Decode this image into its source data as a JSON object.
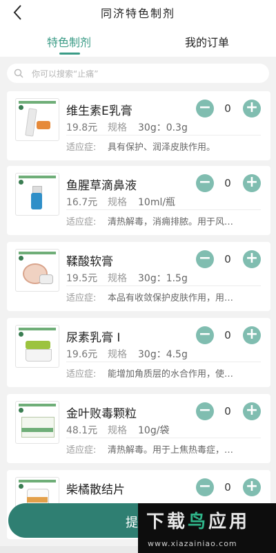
{
  "header": {
    "title": "同济特色制剂"
  },
  "tabs": [
    {
      "label": "特色制剂",
      "active": true
    },
    {
      "label": "我的订单",
      "active": false
    }
  ],
  "search": {
    "placeholder": "你可以搜索“止痛”"
  },
  "labels": {
    "spec": "规格",
    "indication": "适应症:"
  },
  "products": [
    {
      "name": "维生素E乳膏",
      "price": "19.8元",
      "spec": "30g：0.3g",
      "indication": "具有保护、润泽皮肤作用。",
      "qty": "0"
    },
    {
      "name": "鱼腥草滴鼻液",
      "price": "16.7元",
      "spec": "10ml/瓶",
      "indication": "清热解毒，消痈排脓。用于风…",
      "qty": "0"
    },
    {
      "name": "鞣酸软膏",
      "price": "19.5元",
      "spec": "30g：1.5g",
      "indication": "本品有收敛保护皮肤作用，用…",
      "qty": "0"
    },
    {
      "name": "尿素乳膏 I",
      "price": "19.6元",
      "spec": "30g：4.5g",
      "indication": "能增加角质层的水合作用，使…",
      "qty": "0"
    },
    {
      "name": "金叶败毒颗粒",
      "price": "48.1元",
      "spec": "10g/袋",
      "indication": "清热解毒。用于上焦热毒症，…",
      "qty": "0"
    },
    {
      "name": "柴橘散结片",
      "price": "",
      "spec": "",
      "indication": "",
      "qty": "0"
    }
  ],
  "submit": {
    "label": "提"
  },
  "watermark": {
    "main_prefix": "下载",
    "main_accent": "鸟",
    "main_suffix": "应用",
    "url": "www.xiazainiao.com"
  },
  "colors": {
    "accent": "#3a9b86",
    "stepper": "#80bdb0",
    "submit": "#2f7f72"
  },
  "icons": {
    "back": "back-arrow-icon",
    "search": "search-icon",
    "minus": "minus-icon",
    "plus": "plus-icon"
  }
}
